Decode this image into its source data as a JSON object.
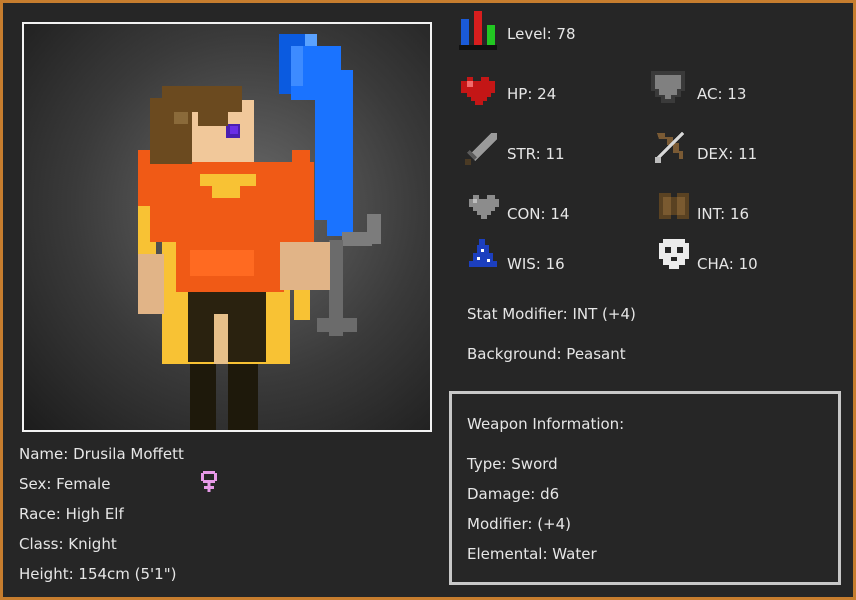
{
  "character": {
    "name": "Name: Drusila Moffett",
    "sex": "Sex: Female",
    "race": "Race: High Elf",
    "class": "Class: Knight",
    "height": "Height: 154cm (5'1\")"
  },
  "stats": {
    "level": "Level: 78",
    "hp": "HP: 24",
    "ac": "AC: 13",
    "str": "STR: 11",
    "dex": "DEX: 11",
    "con": "CON: 14",
    "int": "INT: 16",
    "wis": "WIS: 16",
    "cha": "CHA: 10"
  },
  "stat_modifier": "Stat Modifier: INT (+4)",
  "background": "Background: Peasant",
  "weapon": {
    "heading": "Weapon Information:",
    "type": "Type: Sword",
    "damage": "Damage: d6",
    "modifier": "Modifier: (+4)",
    "elemental": "Elemental: Water"
  },
  "colors": {
    "frame_border": "#c67d2e",
    "panel_bg": "#262626",
    "text": "#e6e6e6",
    "female_symbol": "#e79ae8",
    "weapon_blue": "#1a73ff"
  },
  "icons": {
    "level": "level-bars-icon",
    "hp": "heart-icon",
    "ac": "shield-icon",
    "str": "sword-icon",
    "dex": "bow-icon",
    "con": "gray-heart-icon",
    "int": "book-icon",
    "wis": "wizard-hat-icon",
    "cha": "skull-icon",
    "sex": "female-symbol-icon"
  }
}
